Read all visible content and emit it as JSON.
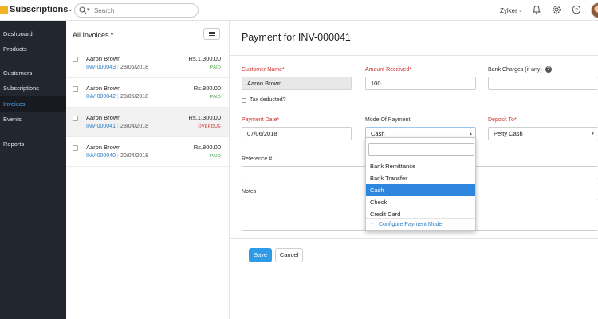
{
  "app": {
    "title": "Subscriptions"
  },
  "search": {
    "placeholder": "Search"
  },
  "header": {
    "org_name": "Zylker"
  },
  "icons": {
    "app_logo": "app-logo-icon",
    "search": "search-icon",
    "notifications": "bell-icon",
    "settings": "gear-icon",
    "help": "help-icon"
  },
  "colors": {
    "accent": "#2e9be6",
    "sidebar_bg": "#22262e",
    "required": "#d0312d",
    "paid": "#3a9a3a",
    "overdue": "#d0312d",
    "link": "#2b7bc4"
  },
  "sidebar": {
    "items": [
      {
        "label": "Dashboard"
      },
      {
        "label": "Products"
      },
      {
        "label": "Customers"
      },
      {
        "label": "Subscriptions"
      },
      {
        "label": "Invoices",
        "active": true
      },
      {
        "label": "Events"
      },
      {
        "label": "Reports"
      }
    ]
  },
  "list": {
    "title": "All Invoices",
    "invoices": [
      {
        "customer": "Aaron Brown",
        "number": "INV-000043",
        "date": "28/05/2018",
        "amount": "Rs.1,300.00",
        "status": "PAID"
      },
      {
        "customer": "Aaron Brown",
        "number": "INV-000042",
        "date": "20/05/2018",
        "amount": "Rs.800.00",
        "status": "PAID"
      },
      {
        "customer": "Aaron Brown",
        "number": "INV-000041",
        "date": "28/04/2018",
        "amount": "Rs.1,300.00",
        "status": "OVERDUE",
        "selected": true
      },
      {
        "customer": "Aaron Brown",
        "number": "INV-000040",
        "date": "20/04/2018",
        "amount": "Rs.800.00",
        "status": "PAID"
      }
    ]
  },
  "form": {
    "title": "Payment for INV-000041",
    "customer_name": {
      "label": "Customer Name*",
      "value": "Aaron Brown"
    },
    "amount_received": {
      "label": "Amount Received*",
      "value": "100"
    },
    "bank_charges": {
      "label": "Bank Charges (if any)",
      "value": ""
    },
    "tax_deducted": {
      "label": "Tax deducted?"
    },
    "payment_date": {
      "label": "Payment Date*",
      "value": "07/06/2018"
    },
    "mode_of_payment": {
      "label": "Mode Of Payment",
      "value": "Cash"
    },
    "deposit_to": {
      "label": "Deposit To*",
      "value": "Petty Cash"
    },
    "reference": {
      "label": "Reference #",
      "value": ""
    },
    "notes": {
      "label": "Notes",
      "value": ""
    },
    "save_label": "Save",
    "cancel_label": "Cancel"
  },
  "dropdown": {
    "options": [
      "Bank Remittance",
      "Bank Transfer",
      "Cash",
      "Check",
      "Credit Card"
    ],
    "selected": "Cash",
    "configure_label": "Configure Payment Mode"
  }
}
